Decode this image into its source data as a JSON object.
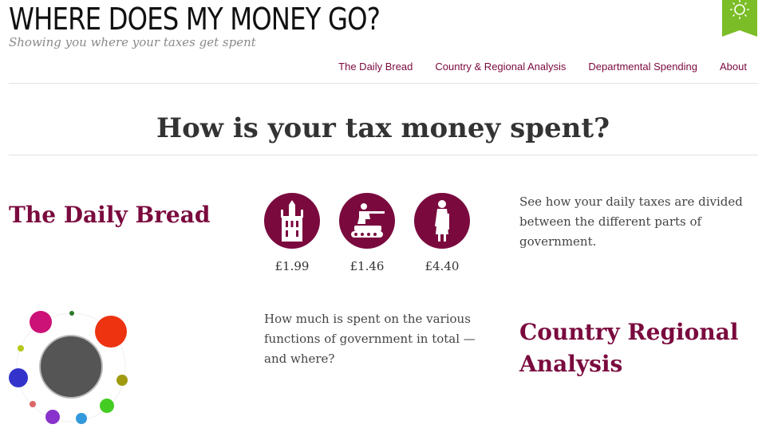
{
  "header": {
    "site_title": "WHERE DOES MY MONEY GO?",
    "tagline": "Showing you where your taxes get spent",
    "ribbon_color": "#7bbd26",
    "ribbon_icon": "sun-burst-icon"
  },
  "nav": {
    "items": [
      {
        "label": "The Daily Bread"
      },
      {
        "label": "Country & Regional Analysis"
      },
      {
        "label": "Departmental Spending"
      },
      {
        "label": "About"
      }
    ],
    "link_color": "#7a0a3e"
  },
  "main": {
    "headline": "How is your tax money spent?",
    "daily_bread": {
      "title": "The Daily Bread",
      "description": "See how your daily taxes are divided between the different parts of government.",
      "icons": [
        {
          "icon": "government-building-icon",
          "amount": "£1.99"
        },
        {
          "icon": "soldier-tank-icon",
          "amount": "£1.46"
        },
        {
          "icon": "elderly-person-icon",
          "amount": "£4.40"
        }
      ],
      "circle_color": "#7a0a3e"
    },
    "regional": {
      "title": "Country Regional Analysis",
      "description": "How much is spent on the various functions of government in total — and where?",
      "bubbles": [
        {
          "color": "#555555"
        },
        {
          "color": "#cc1177"
        },
        {
          "color": "#ee3311"
        },
        {
          "color": "#2a7a2a"
        },
        {
          "color": "#b5c91a"
        },
        {
          "color": "#3333cc"
        },
        {
          "color": "#a09a10"
        },
        {
          "color": "#44cc22"
        },
        {
          "color": "#dd6666"
        },
        {
          "color": "#8833cc"
        },
        {
          "color": "#3399dd"
        }
      ]
    }
  }
}
